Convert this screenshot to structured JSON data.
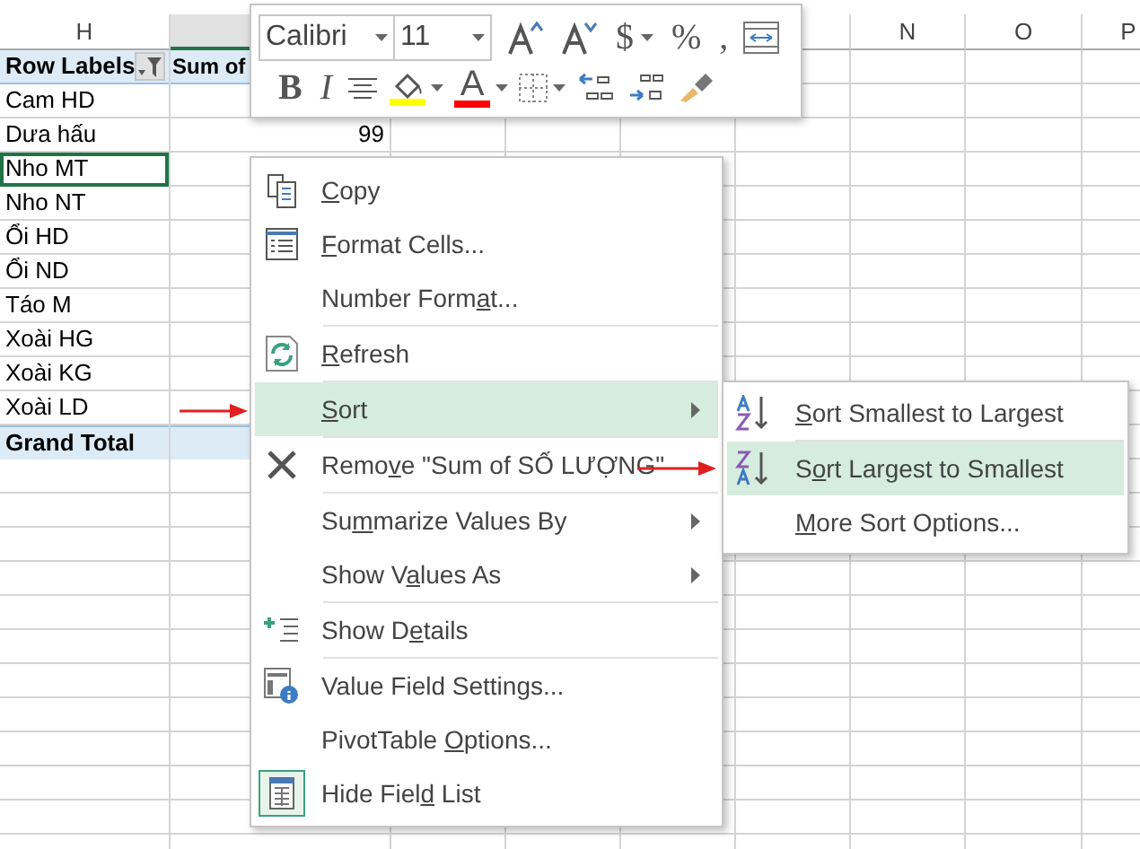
{
  "columns": [
    {
      "label": "H",
      "selected": false
    },
    {
      "selected": true
    },
    {
      "label": "N",
      "selected": false
    },
    {
      "label": "O",
      "selected": false
    },
    {
      "label": "P",
      "selected": false
    }
  ],
  "pivot": {
    "rows": [
      {
        "kind": "header",
        "label": "Row Labels",
        "value": "Sum of",
        "selected": false
      },
      {
        "kind": "item",
        "label": "Cam HD",
        "selected": false
      },
      {
        "kind": "item",
        "label": "Dưa hấu",
        "value": "99",
        "selected": false
      },
      {
        "kind": "item",
        "label": "Nho MT",
        "selected": true
      },
      {
        "kind": "item",
        "label": "Nho NT",
        "selected": false
      },
      {
        "kind": "item",
        "label": "Ổi HD",
        "selected": false
      },
      {
        "kind": "item",
        "label": "Ổi ND",
        "selected": false
      },
      {
        "kind": "item",
        "label": "Táo M",
        "selected": false
      },
      {
        "kind": "item",
        "label": "Xoài HG",
        "selected": false
      },
      {
        "kind": "item",
        "label": "Xoài KG",
        "selected": false
      },
      {
        "kind": "item",
        "label": "Xoài LD",
        "selected": false
      },
      {
        "kind": "total",
        "label": "Grand Total",
        "selected": false
      }
    ]
  },
  "mini_toolbar": {
    "font": "Calibri",
    "size": "11",
    "row1": [
      {
        "kind": "grow"
      },
      {
        "kind": "shrink"
      },
      {
        "kind": "text",
        "label": "$",
        "dropdown": true
      },
      {
        "kind": "text",
        "label": "%",
        "dropdown": false
      },
      {
        "kind": "text",
        "label": ",",
        "dropdown": false
      },
      {
        "kind": "wrap"
      }
    ],
    "row2": [
      {
        "kind": "text",
        "label": "B",
        "bold": true,
        "dropdown": false
      },
      {
        "kind": "text",
        "label": "I",
        "italic": true,
        "dropdown": false
      },
      {
        "kind": "align"
      },
      {
        "kind": "fill",
        "color": "#ffff00",
        "dropdown": true
      },
      {
        "kind": "fontcolor",
        "label": "A",
        "color": "#ff0000",
        "dropdown": true
      },
      {
        "kind": "borders",
        "dropdown": true
      },
      {
        "kind": "incdec"
      },
      {
        "kind": "decdec"
      },
      {
        "kind": "painter"
      }
    ]
  },
  "context_menu": {
    "items": [
      {
        "kind": "item",
        "label": "Copy",
        "selected": false,
        "has_submenu": false,
        "checked": false
      },
      {
        "kind": "item",
        "label": "Format Cells...",
        "selected": false,
        "has_submenu": false,
        "checked": false
      },
      {
        "kind": "item",
        "label": "Number Format...",
        "selected": false,
        "has_submenu": false,
        "checked": false
      },
      {
        "kind": "separator"
      },
      {
        "kind": "item",
        "label": "Refresh",
        "selected": false,
        "has_submenu": false,
        "checked": false
      },
      {
        "kind": "separator"
      },
      {
        "kind": "item",
        "label": "Sort",
        "selected": true,
        "has_submenu": true,
        "checked": false,
        "submenu": [
          {
            "kind": "item",
            "label": "Sort Smallest to Largest",
            "selected": false
          },
          {
            "kind": "separator"
          },
          {
            "kind": "item",
            "label": "Sort Largest to Smallest",
            "selected": true
          },
          {
            "kind": "item",
            "label": "More Sort Options...",
            "selected": false
          }
        ]
      },
      {
        "kind": "separator"
      },
      {
        "kind": "item",
        "label": "Remove \"Sum of SỐ LƯỢNG\"",
        "selected": false,
        "has_submenu": false,
        "checked": false
      },
      {
        "kind": "separator"
      },
      {
        "kind": "item",
        "label": "Summarize Values By",
        "selected": false,
        "has_submenu": true,
        "checked": false
      },
      {
        "kind": "item",
        "label": "Show Values As",
        "selected": false,
        "has_submenu": true,
        "checked": false
      },
      {
        "kind": "separator"
      },
      {
        "kind": "item",
        "label": "Show Details",
        "selected": false,
        "has_submenu": false,
        "checked": false
      },
      {
        "kind": "separator"
      },
      {
        "kind": "item",
        "label": "Value Field Settings...",
        "selected": false,
        "has_submenu": false,
        "checked": false
      },
      {
        "kind": "item",
        "label": "PivotTable Options...",
        "selected": false,
        "has_submenu": false,
        "checked": false
      },
      {
        "kind": "item",
        "label": "Hide Field List",
        "selected": false,
        "has_submenu": false,
        "checked": true
      }
    ]
  }
}
